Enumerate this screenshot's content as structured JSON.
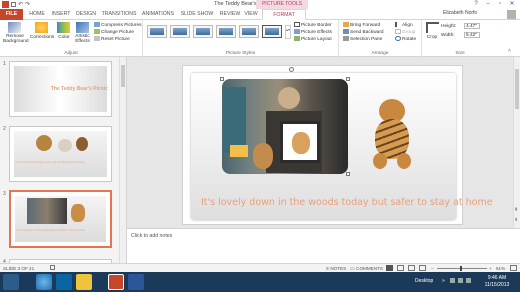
{
  "window": {
    "title": "The Teddy Bear's Picnic - PowerPoint",
    "context_tab": "PICTURE TOOLS",
    "user": "Elizabeth Norfo",
    "help_icon": "question-icon",
    "min_icon": "minimize-icon",
    "restore_icon": "restore-icon",
    "close_icon": "close-icon"
  },
  "tabs": [
    "FILE",
    "HOME",
    "INSERT",
    "DESIGN",
    "TRANSITIONS",
    "ANIMATIONS",
    "SLIDE SHOW",
    "REVIEW",
    "VIEW",
    "FORMAT"
  ],
  "ribbon": {
    "adjust": {
      "remove_background": "Remove Background",
      "corrections": "Corrections",
      "color": "Color",
      "artistic_effects": "Artistic Effects",
      "compress": "Compress Pictures",
      "change": "Change Picture",
      "reset": "Reset Picture",
      "label": "Adjust"
    },
    "styles": {
      "label": "Picture Styles",
      "border": "Picture Border",
      "effects": "Picture Effects",
      "layout": "Picture Layout"
    },
    "arrange": {
      "label": "Arrange",
      "bring_forward": "Bring Forward",
      "send_backward": "Send Backward",
      "selection_pane": "Selection Pane",
      "align": "Align",
      "group": "Group",
      "rotate": "Rotate"
    },
    "size": {
      "label": "Size",
      "crop": "Crop",
      "height_label": "Height:",
      "height_value": "4.47\"",
      "width_label": "Width:",
      "width_value": "5.42\""
    }
  },
  "slides": [
    {
      "num": "1",
      "title": "The Teddy Bear's Picnic"
    },
    {
      "num": "2",
      "caption": "Lots of marvelous things to eat, and wonderful games to play"
    },
    {
      "num": "3",
      "caption": "It's lovely down in the woods today but safer to stay at home"
    },
    {
      "num": "4"
    }
  ],
  "slide": {
    "caption": "It's lovely down in the woods today but safer to stay at home"
  },
  "notes": {
    "placeholder": "Click to add notes"
  },
  "status": {
    "slide_of": "SLIDE 3 OF 21",
    "notes": "NOTES",
    "comments": "COMMENTS",
    "zoom": "61%"
  },
  "taskbar": {
    "desktop": "Desktop",
    "time": "9:46 AM",
    "date": "11/15/2013"
  },
  "colors": {
    "accent": "#c4472c",
    "context": "#c0395a",
    "caption": "#e8a07c",
    "taskbar": "#1b3a5a"
  }
}
